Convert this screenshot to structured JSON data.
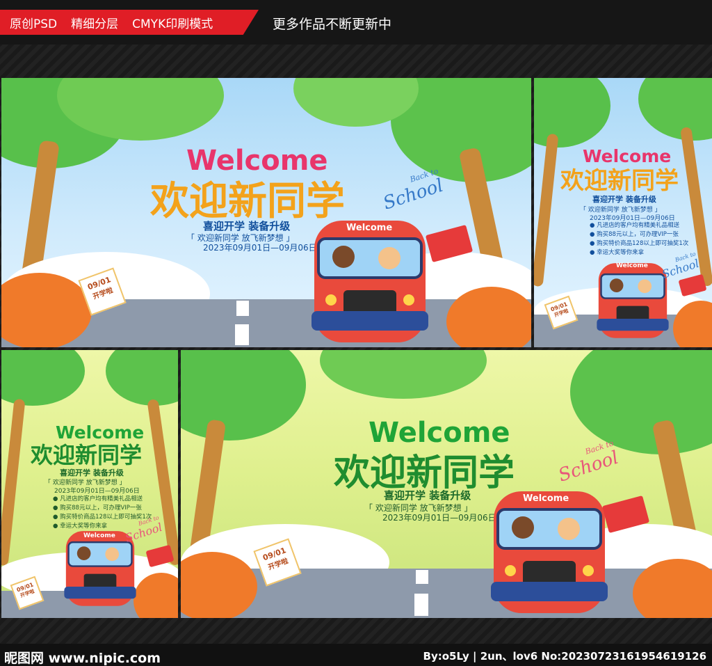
{
  "header": {
    "tags": [
      "原创PSD",
      "精细分层",
      "CMYK印刷模式"
    ],
    "more": "更多作品不断更新中"
  },
  "poster": {
    "welcome": "Welcome",
    "headline": "欢迎新同学",
    "slogan": "喜迎开学 装备升级",
    "tagline": "「 欢迎新同学  放飞新梦想 」",
    "date": "2023年09月01日—09月06日",
    "bullets": [
      "凡进店的客户均有精美礼品相送",
      "购买88元以上，可办理VIP一张",
      "购买特价商品128以上即可抽奖1次",
      "幸运大奖等你来拿"
    ],
    "bus_sign": "Welcome",
    "back_to": "Back to",
    "school_script": "School",
    "calendar_date": "09/01",
    "calendar_text": "开学啦"
  },
  "colors": {
    "brand_red": "#e01e26",
    "welcome_pink": "#e8356b",
    "green_title": "#1f8d2f",
    "text_blue": "#114f9c"
  },
  "footer": {
    "logo": "昵图网 www.nipic.com",
    "credit": "By:o5Ly | 2un、lov6 No:20230723161954619126"
  }
}
